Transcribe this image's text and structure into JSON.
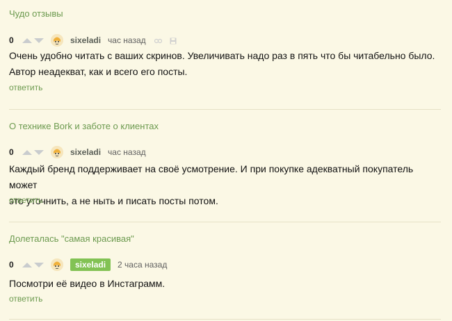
{
  "comments": [
    {
      "post_title": "Чудо отзывы",
      "rating": "0",
      "username": "sixeladi",
      "time": "час назад",
      "lines": [
        "Очень удобно читать с ваших скринов. Увеличивать надо раз в пять что бы читабельно было.",
        "Автор неадекват, как и всего его посты."
      ],
      "reply_label": "ответить"
    },
    {
      "post_title": "О технике Bork и заботе о клиентах",
      "rating": "0",
      "username": "sixeladi",
      "time": "час назад",
      "lines": [
        "Каждый бренд поддерживает на своё усмотрение. И при покупке адекватный покупатель может",
        "это уточнить, а не ныть и писать посты потом."
      ],
      "reply_label": "ответить"
    },
    {
      "post_title": "Долеталась \"самая красивая\"",
      "rating": "0",
      "username": "sixeladi",
      "time": "2 часа назад",
      "lines": [
        "Посмотри её видео в Инстаграмм."
      ],
      "reply_label": "ответить"
    }
  ],
  "colors": {
    "background": "#fbf8e5",
    "link_green": "#6c9a4f",
    "badge_green": "#82c254",
    "divider": "#e6e1c6"
  },
  "icons": [
    "vote-up-icon",
    "vote-down-icon",
    "avatar",
    "link-icon",
    "save-icon"
  ]
}
